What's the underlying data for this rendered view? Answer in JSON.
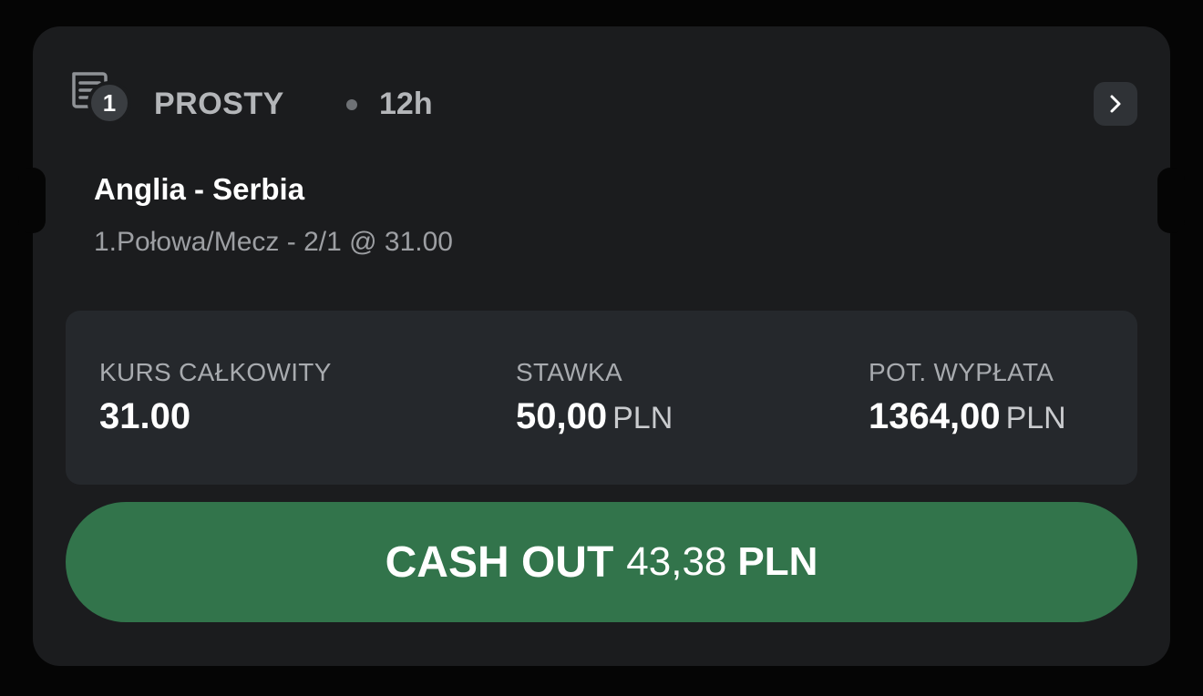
{
  "header": {
    "bet_count": "1",
    "bet_type": "PROSTY",
    "time": "12h",
    "icon": "ticket-icon",
    "action_icon": "chevron-right-icon"
  },
  "bet": {
    "event": "Anglia - Serbia",
    "selection": "1.Połowa/Mecz - 2/1 @ 31.00"
  },
  "summary": {
    "total_odds": {
      "label": "KURS CAŁKOWITY",
      "value": "31.00"
    },
    "stake": {
      "label": "STAWKA",
      "value": "50,00",
      "currency": "PLN"
    },
    "potential_payout": {
      "label": "POT. WYPŁATA",
      "value": "1364,00",
      "currency": "PLN"
    }
  },
  "cashout": {
    "label": "CASH OUT",
    "amount": "43,38",
    "currency": "PLN",
    "color": "#32744b"
  }
}
